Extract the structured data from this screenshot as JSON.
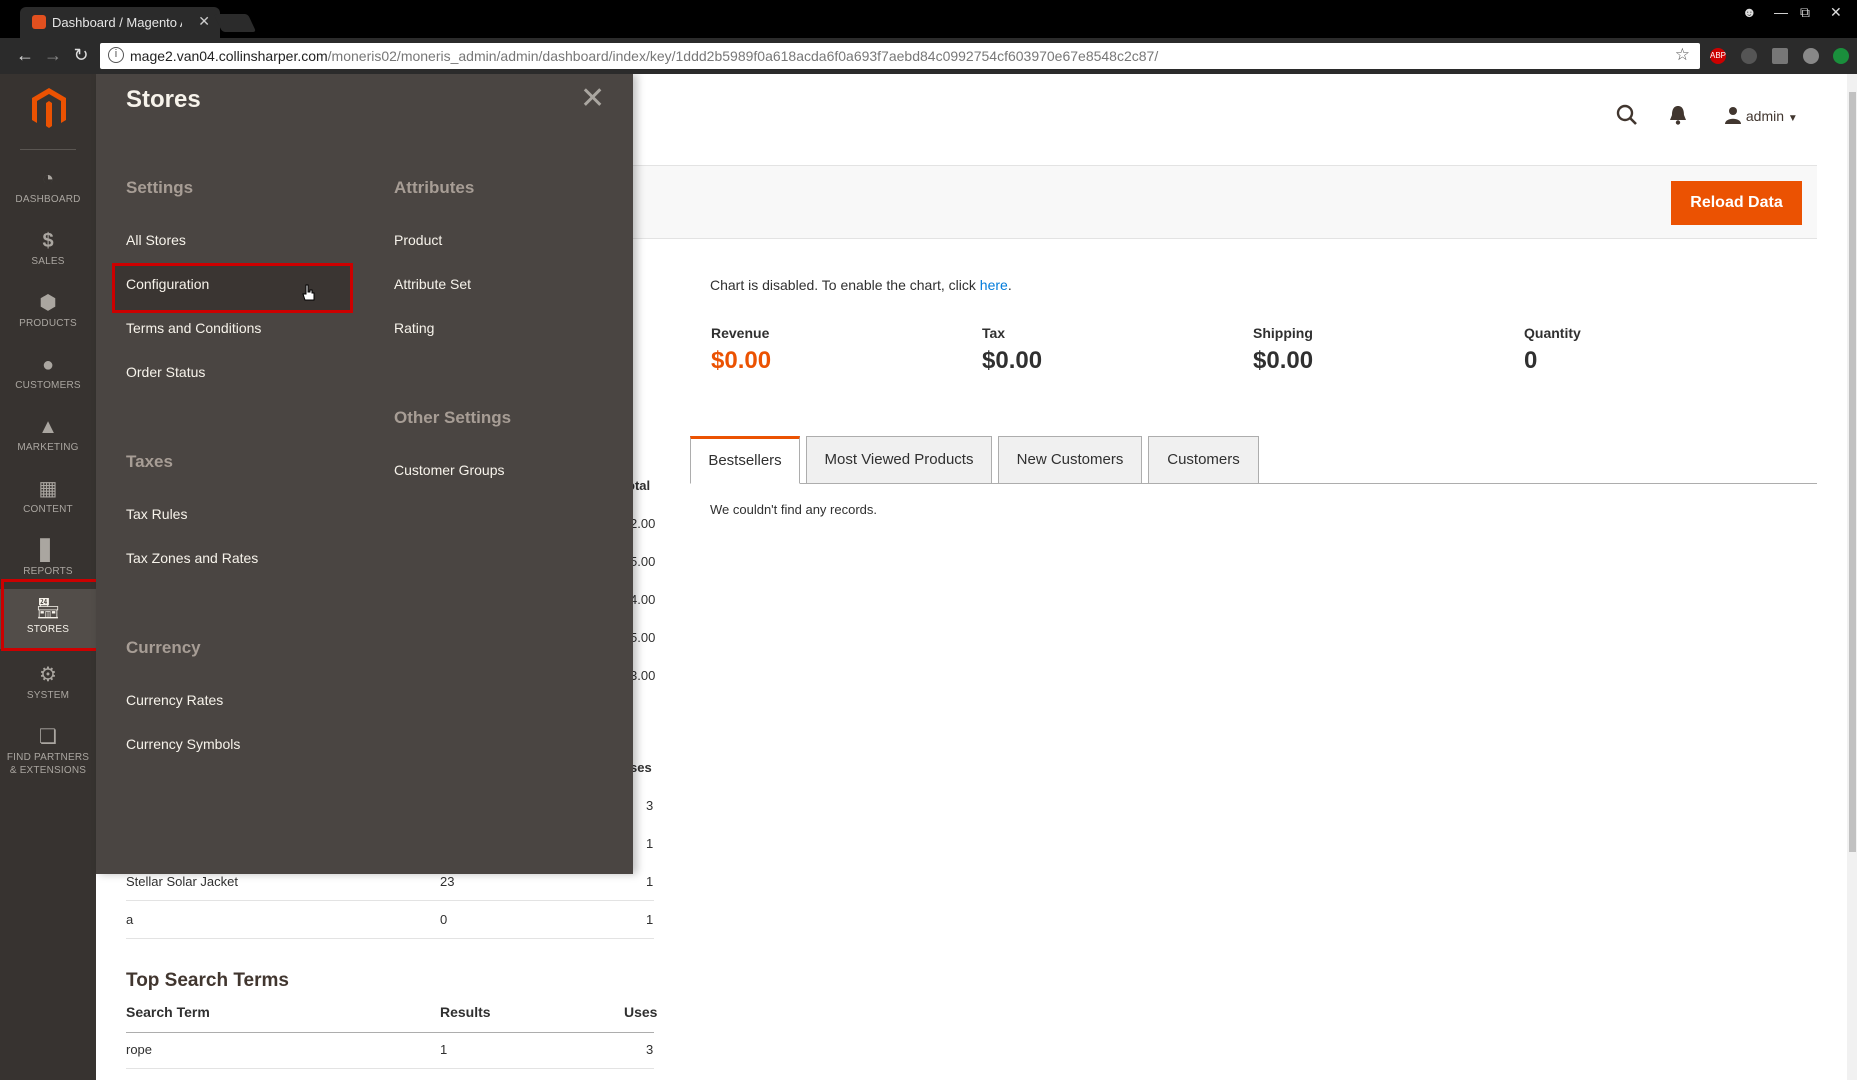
{
  "browser": {
    "tab_title": "Dashboard / Magento A",
    "tab_close": "✕",
    "url_host": "mage2.van04.collinsharper.com",
    "url_path": "/moneris02/moneris_admin/admin/dashboard/index/key/1ddd2b5989f0a618acda6f0a693f7aebd84c0992754cf603970e67e8548c2c87/",
    "ext_abp": "ABP"
  },
  "sidebar": {
    "items": [
      {
        "label": "DASHBOARD",
        "icon": "dashboard-icon"
      },
      {
        "label": "SALES",
        "icon": "dollar-icon"
      },
      {
        "label": "PRODUCTS",
        "icon": "box-icon"
      },
      {
        "label": "CUSTOMERS",
        "icon": "person-icon"
      },
      {
        "label": "MARKETING",
        "icon": "megaphone-icon"
      },
      {
        "label": "CONTENT",
        "icon": "layout-icon"
      },
      {
        "label": "REPORTS",
        "icon": "bar-chart-icon"
      },
      {
        "label": "STORES",
        "icon": "storefront-icon"
      },
      {
        "label": "SYSTEM",
        "icon": "gear-icon"
      },
      {
        "label": "FIND PARTNERS",
        "label2": "& EXTENSIONS",
        "icon": "cube-icon"
      }
    ]
  },
  "header": {
    "user": "admin",
    "reload": "Reload Data"
  },
  "dashboard": {
    "chart_msg": "Chart is disabled. To enable the chart, click",
    "chart_link": "here",
    "totals": [
      {
        "label": "Revenue",
        "value": "$0.00"
      },
      {
        "label": "Tax",
        "value": "$0.00"
      },
      {
        "label": "Shipping",
        "value": "$0.00"
      },
      {
        "label": "Quantity",
        "value": "0"
      }
    ],
    "tabs": [
      "Bestsellers",
      "Most Viewed Products",
      "New Customers",
      "Customers"
    ],
    "no_records": "We couldn't find any records.",
    "partial_header_total": "otal",
    "partial_totals": [
      "2.00",
      "5.00",
      "4.00",
      "5.00",
      "3.00"
    ],
    "partial_header_uses": "ses",
    "partial_uses": [
      "3",
      "1"
    ],
    "rows": [
      {
        "term": "Stellar Solar Jacket",
        "results": "23",
        "uses": "1"
      },
      {
        "term": "a",
        "results": "0",
        "uses": "1"
      }
    ],
    "top_search_title": "Top Search Terms",
    "top_search_headers": [
      "Search Term",
      "Results",
      "Uses"
    ],
    "top_search_rows": [
      {
        "term": "rope",
        "results": "1",
        "uses": "3"
      }
    ]
  },
  "flyout": {
    "title": "Stores",
    "close": "✕",
    "settings_title": "Settings",
    "settings": [
      "All Stores",
      "Configuration",
      "Terms and Conditions",
      "Order Status"
    ],
    "taxes_title": "Taxes",
    "taxes": [
      "Tax Rules",
      "Tax Zones and Rates"
    ],
    "currency_title": "Currency",
    "currency": [
      "Currency Rates",
      "Currency Symbols"
    ],
    "attributes_title": "Attributes",
    "attributes": [
      "Product",
      "Attribute Set",
      "Rating"
    ],
    "other_title": "Other Settings",
    "other": [
      "Customer Groups"
    ]
  },
  "colors": {
    "accent": "#eb5202",
    "sidebar_bg": "#373330",
    "flyout_bg": "#4a4542",
    "highlight": "#cc0000",
    "link": "#007bdb"
  }
}
